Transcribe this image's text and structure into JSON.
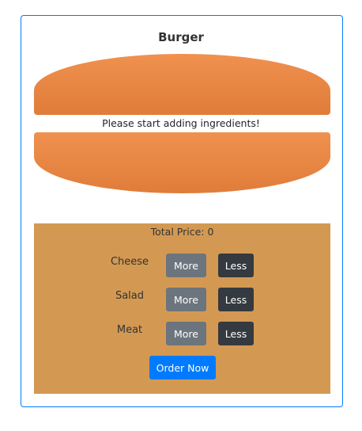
{
  "burger": {
    "title": "Burger",
    "message": "Please start adding ingredients!"
  },
  "controls": {
    "total_price_label": "Total Price: 0",
    "ingredients": [
      {
        "label": "Cheese",
        "more": "More",
        "less": "Less"
      },
      {
        "label": "Salad",
        "more": "More",
        "less": "Less"
      },
      {
        "label": "Meat",
        "more": "More",
        "less": "Less"
      }
    ],
    "order_label": "Order Now"
  }
}
